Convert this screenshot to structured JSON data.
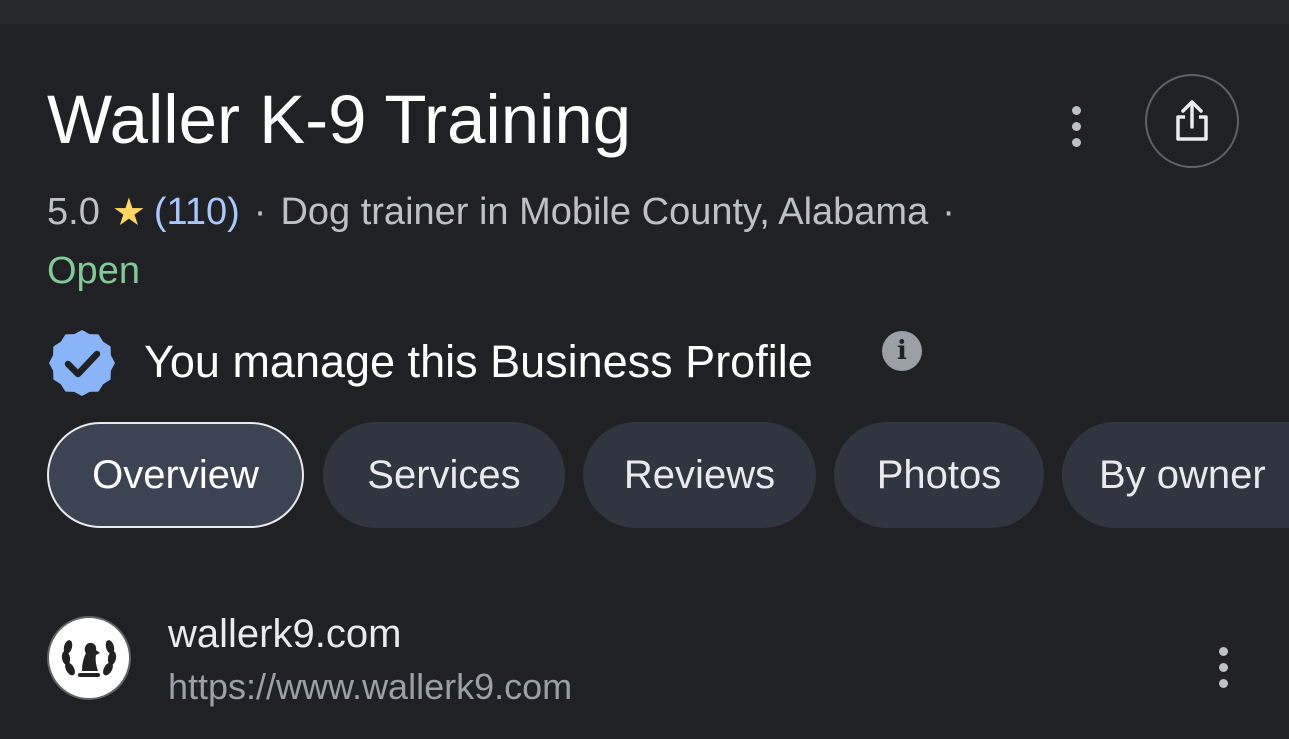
{
  "header": {
    "title": "Waller K-9 Training",
    "more_icon": "vertical-dots-icon",
    "share_icon": "share-icon"
  },
  "meta": {
    "rating": "5.0",
    "star": "★",
    "review_count": "(110)",
    "separator": "·",
    "category": "Dog trainer in Mobile County, Alabama",
    "trailing_separator": "·",
    "status": "Open"
  },
  "manage": {
    "text": "You manage this Business Profile",
    "info_glyph": "i"
  },
  "tabs": [
    {
      "label": "Overview",
      "selected": true
    },
    {
      "label": "Services",
      "selected": false
    },
    {
      "label": "Reviews",
      "selected": false
    },
    {
      "label": "Photos",
      "selected": false
    },
    {
      "label": "By owner",
      "selected": false
    }
  ],
  "website": {
    "name": "wallerk9.com",
    "url": "https://www.wallerk9.com"
  },
  "colors": {
    "background": "#202124",
    "link_blue": "#a8c7fa",
    "star_yellow": "#fdd663",
    "open_green": "#81c995",
    "verified_blue": "#8ab4f8"
  }
}
